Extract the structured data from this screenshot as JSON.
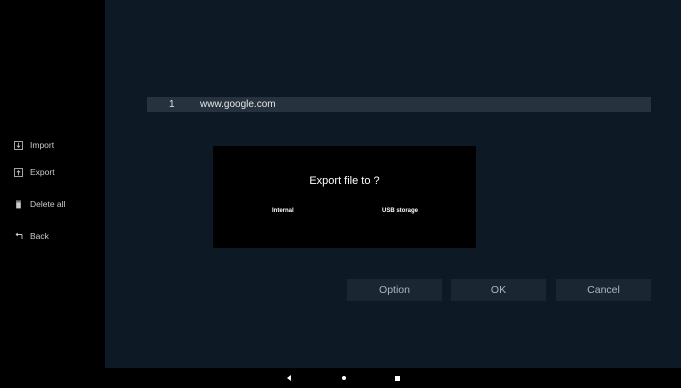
{
  "sidebar": {
    "items": [
      {
        "label": "Import",
        "icon": "import-icon"
      },
      {
        "label": "Export",
        "icon": "export-icon"
      },
      {
        "label": "Delete all",
        "icon": "trash-icon"
      },
      {
        "label": "Back",
        "icon": "back-arrow-icon"
      }
    ]
  },
  "list": {
    "rows": [
      {
        "index": "1",
        "url": "www.google.com"
      }
    ]
  },
  "dialog": {
    "title": "Export file to ?",
    "options": [
      "Internal",
      "USB storage"
    ]
  },
  "actions": {
    "option_label": "Option",
    "ok_label": "OK",
    "cancel_label": "Cancel"
  },
  "colors": {
    "sidebar_bg": "#000000",
    "main_bg": "#0d1a26",
    "row_bg": "#26323d",
    "button_bg": "#1a2631",
    "dialog_bg": "#000000"
  },
  "navbar": {
    "buttons": [
      "back-triangle-icon",
      "home-dot-icon",
      "recents-square-icon"
    ]
  }
}
